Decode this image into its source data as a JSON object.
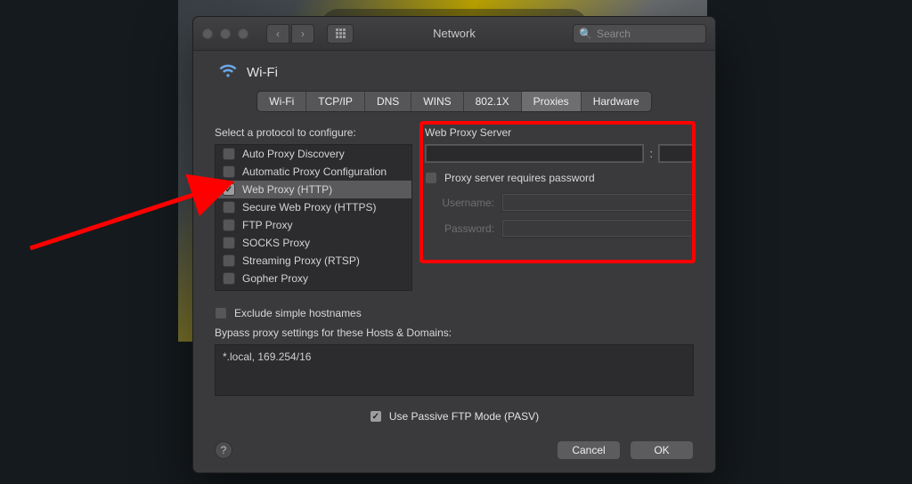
{
  "window": {
    "title": "Network"
  },
  "search": {
    "placeholder": "Search",
    "value": ""
  },
  "interface": {
    "name": "Wi-Fi"
  },
  "tabs": [
    {
      "label": "Wi-Fi",
      "active": false
    },
    {
      "label": "TCP/IP",
      "active": false
    },
    {
      "label": "DNS",
      "active": false
    },
    {
      "label": "WINS",
      "active": false
    },
    {
      "label": "802.1X",
      "active": false
    },
    {
      "label": "Proxies",
      "active": true
    },
    {
      "label": "Hardware",
      "active": false
    }
  ],
  "protocols": {
    "label": "Select a protocol to configure:",
    "items": [
      {
        "label": "Auto Proxy Discovery",
        "checked": false,
        "selected": false
      },
      {
        "label": "Automatic Proxy Configuration",
        "checked": false,
        "selected": false
      },
      {
        "label": "Web Proxy (HTTP)",
        "checked": true,
        "selected": true
      },
      {
        "label": "Secure Web Proxy (HTTPS)",
        "checked": false,
        "selected": false
      },
      {
        "label": "FTP Proxy",
        "checked": false,
        "selected": false
      },
      {
        "label": "SOCKS Proxy",
        "checked": false,
        "selected": false
      },
      {
        "label": "Streaming Proxy (RTSP)",
        "checked": false,
        "selected": false
      },
      {
        "label": "Gopher Proxy",
        "checked": false,
        "selected": false
      }
    ]
  },
  "server": {
    "label": "Web Proxy Server",
    "host": "",
    "port": "",
    "requires_password_label": "Proxy server requires password",
    "requires_password": false,
    "username_label": "Username:",
    "username": "",
    "password_label": "Password:",
    "password": ""
  },
  "exclude": {
    "label": "Exclude simple hostnames",
    "checked": false
  },
  "bypass": {
    "label": "Bypass proxy settings for these Hosts & Domains:",
    "value": "*.local, 169.254/16"
  },
  "pasv": {
    "label": "Use Passive FTP Mode (PASV)",
    "checked": true
  },
  "buttons": {
    "cancel": "Cancel",
    "ok": "OK"
  }
}
